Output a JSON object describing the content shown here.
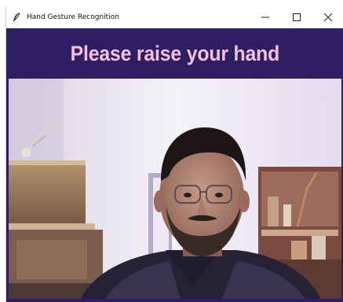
{
  "window": {
    "title": "Hand Gesture Recognition",
    "app_icon": "feather-icon",
    "controls": {
      "minimize_icon": "minimize-icon",
      "maximize_icon": "maximize-icon",
      "close_icon": "close-icon"
    }
  },
  "main": {
    "heading": "Please raise your hand",
    "camera_feed": "webcam-video-feed"
  },
  "colors": {
    "band_background": "#2e1f62",
    "heading_text": "#f4c0dc",
    "titlebar_background": "#ffffff"
  }
}
